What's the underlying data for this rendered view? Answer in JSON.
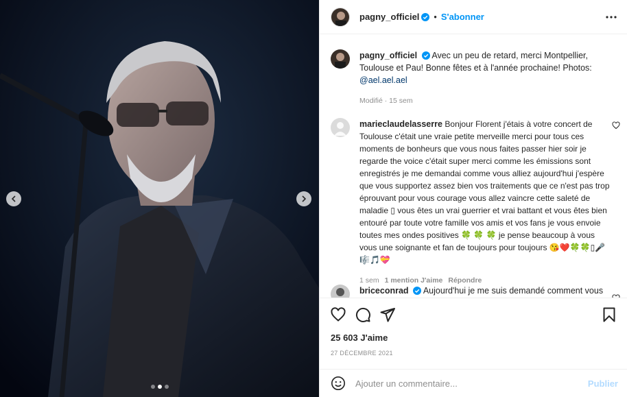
{
  "post": {
    "author": "pagny_officiel",
    "follow_label": "S'abonner",
    "separator": "•",
    "caption_text": "Avec un peu de retard, merci Montpellier, Toulouse et Pau! Bonne fêtes et à l'année prochaine! Photos: ",
    "caption_mention": "@ael.ael.ael",
    "caption_meta": "Modifié · 15 sem",
    "likes": "25 603 J'aime",
    "date": "27 DÉCEMBRE 2021",
    "carousel_dots": 3,
    "active_dot": 2
  },
  "comments": [
    {
      "user": "marieclaudelasserre",
      "text": "Bonjour Florent j'étais à votre concert de Toulouse c'était une vraie petite merveille merci pour tous ces moments de bonheurs que vous nous faites passer hier soir je regarde the voice c'était super merci comme les émissions sont enregistrés je me demandai comme vous alliez aujourd'hui j'espère que vous supportez assez bien vos traitements que ce n'est pas trop éprouvant pour vous courage vous allez vaincre cette saleté de maladie ▯ vous êtes un vrai guerrier et vrai battant et vous êtes bien entouré par toute votre famille vos amis et vos fans je vous envoie toutes mes ondes positives 🍀 🍀 🍀 je pense beaucoup à vous vous une soignante et fan de toujours pour toujours 😘❤️🍀🍀▯🎤🎼🎵💝",
      "time": "1 sem",
      "likes": "1 mention J'aime",
      "reply": "Répondre"
    },
    {
      "user": "briceconrad",
      "text": "Aujourd'hui je me suis demandé comment vous"
    }
  ],
  "add_comment": {
    "placeholder": "Ajouter un commentaire...",
    "publish": "Publier"
  },
  "colors": {
    "link_blue": "#0095f6",
    "mention": "#00376b",
    "muted": "#8e8e8e",
    "like_red": "#ed4956"
  }
}
